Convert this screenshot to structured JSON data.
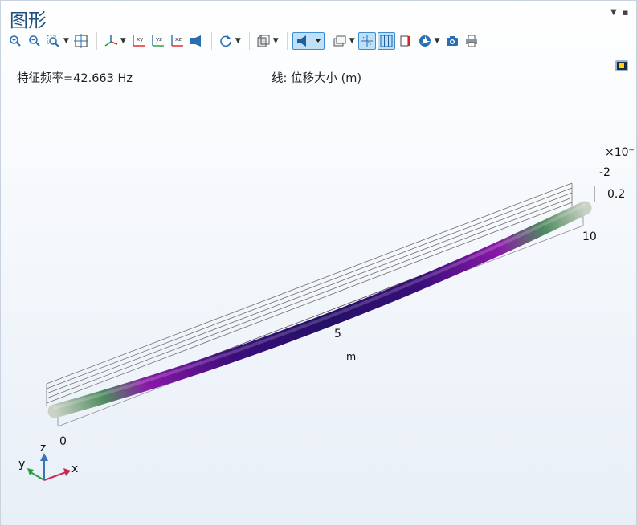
{
  "window": {
    "title": "图形"
  },
  "info": {
    "eigenfrequency_label": "特征频率=42.663 Hz",
    "expression_label": "线: 位移大小 (m)"
  },
  "toolbar": {
    "groups": [
      [
        "zoom-in-icon",
        "zoom-out-icon",
        "zoom-box-icon",
        "zoom-extents-icon"
      ],
      [
        "view-axes-icon",
        "xy-plane-icon",
        "yz-plane-icon",
        "xz-plane-icon",
        "view-camera-icon"
      ],
      [
        "rotate-icon"
      ],
      [
        "transparency-icon"
      ],
      [
        "scene-light-icon",
        "render-mode-icon",
        "wireframe-icon",
        "grid-icon",
        "colorbar-icon",
        "color-wheel-icon",
        "screenshot-icon",
        "print-icon"
      ]
    ]
  },
  "scene": {
    "axis_labels": {
      "x_start": "0",
      "x_mid": "5",
      "x_end": "10",
      "x_unit": "m"
    },
    "scale": {
      "exponent_label": "×10⁻",
      "exponent_value": "-2",
      "z_tick": "0.2"
    },
    "triad": {
      "x": "x",
      "y": "y",
      "z": "z"
    },
    "colors": {
      "end": "#c9d2c4",
      "green": "#4f8a5e",
      "purple": "#8a17a8",
      "indigo": "#2a0f6e"
    }
  }
}
